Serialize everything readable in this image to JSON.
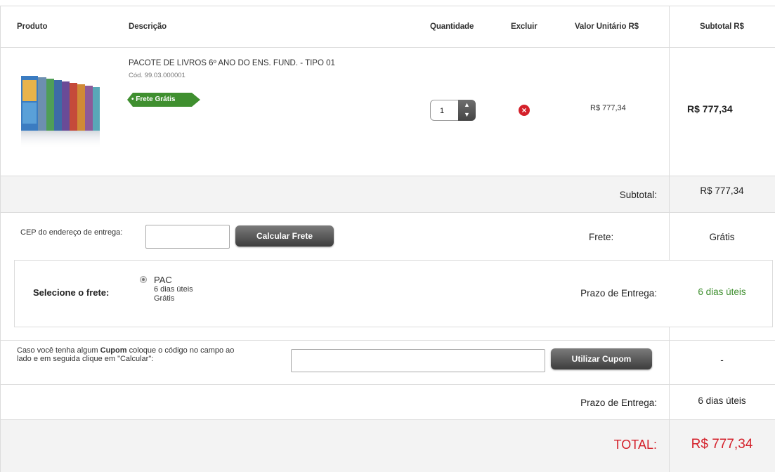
{
  "header": {
    "produto": "Produto",
    "descricao": "Descrição",
    "quantidade": "Quantidade",
    "excluir": "Excluir",
    "valor_unitario": "Valor Unitário R$",
    "subtotal": "Subtotal R$"
  },
  "item": {
    "name": "PACOTE DE LIVROS 6º ANO DO ENS. FUND. - TIPO 01",
    "code": "Cód. 99.03.000001",
    "badge": "• Frete Grátis",
    "quantity": "1",
    "unit_price": "R$ 777,34",
    "subtotal": "R$ 777,34",
    "image_icon": "book-package-image"
  },
  "summary": {
    "subtotal_label": "Subtotal:",
    "subtotal_value": "R$ 777,34"
  },
  "cep": {
    "label": "CEP do endereço de entrega:",
    "value": "",
    "button": "Calcular Frete",
    "frete_label": "Frete:",
    "frete_value": "Grátis"
  },
  "shipping": {
    "select_label": "Selecione o frete:",
    "option_name": "PAC",
    "option_days": "6 dias úteis",
    "option_price": "Grátis",
    "prazo_label": "Prazo de Entrega:",
    "prazo_value": "6 dias úteis"
  },
  "coupon": {
    "text_prefix": "Caso você tenha algum ",
    "text_bold": "Cupom",
    "text_suffix_line1": " coloque o código no campo ao",
    "text_line2": "lado e em seguida clique em \"Calcular\":",
    "value": "",
    "button": "Utilizar Cupom",
    "discount": "-"
  },
  "delivery": {
    "label": "Prazo de Entrega:",
    "value": "6 dias úteis"
  },
  "total": {
    "label": "TOTAL:",
    "value": "R$ 777,34"
  },
  "colors": {
    "accent_green": "#3f8f2f",
    "total_red": "#d4202a",
    "button_dark": "#4a4a4a"
  }
}
